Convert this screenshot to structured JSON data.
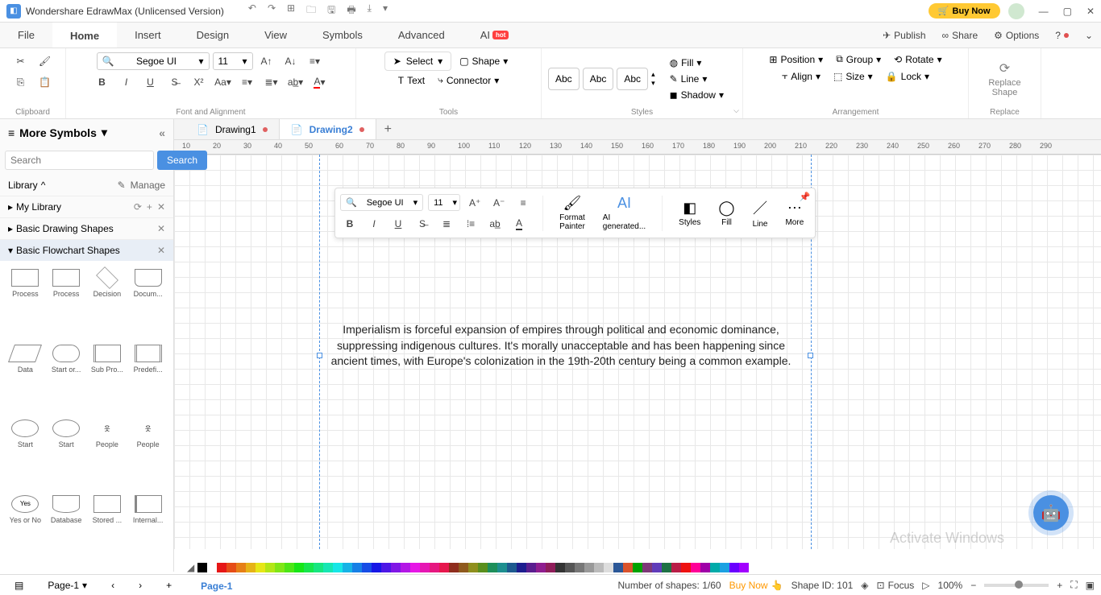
{
  "titlebar": {
    "app_title": "Wondershare EdrawMax (Unlicensed Version)",
    "buynow": "Buy Now"
  },
  "menubar": {
    "file": "File",
    "home": "Home",
    "insert": "Insert",
    "design": "Design",
    "view": "View",
    "symbols": "Symbols",
    "advanced": "Advanced",
    "ai": "AI",
    "hot": "hot",
    "publish": "Publish",
    "share": "Share",
    "options": "Options"
  },
  "ribbon": {
    "clipboard_label": "Clipboard",
    "font_name": "Segoe UI",
    "font_size": "11",
    "font_group_label": "Font and Alignment",
    "select": "Select",
    "shape": "Shape",
    "text": "Text",
    "connector": "Connector",
    "tools_label": "Tools",
    "abc": "Abc",
    "styles_label": "Styles",
    "fill": "Fill",
    "line": "Line",
    "shadow": "Shadow",
    "position": "Position",
    "group": "Group",
    "rotate": "Rotate",
    "align": "Align",
    "size": "Size",
    "lock": "Lock",
    "arrangement_label": "Arrangement",
    "replace_shape": "Replace\nShape",
    "replace_label": "Replace"
  },
  "doc_tabs": {
    "tab1": "Drawing1",
    "tab2": "Drawing2"
  },
  "sidebar": {
    "more_symbols": "More Symbols",
    "search_placeholder": "Search",
    "search_btn": "Search",
    "library": "Library",
    "manage": "Manage",
    "my_library": "My Library",
    "basic_drawing": "Basic Drawing Shapes",
    "basic_flowchart": "Basic Flowchart Shapes",
    "shapes": [
      "Process",
      "Process",
      "Decision",
      "Docum...",
      "Data",
      "Start or...",
      "Sub Pro...",
      "Predefi...",
      "Start",
      "Start",
      "People",
      "People",
      "Yes or No",
      "Database",
      "Stored ...",
      "Internal..."
    ]
  },
  "float_toolbar": {
    "font": "Segoe UI",
    "size": "11",
    "format_painter": "Format\nPainter",
    "ai_generated": "AI\ngenerated...",
    "styles": "Styles",
    "fill": "Fill",
    "line": "Line",
    "more": "More"
  },
  "canvas": {
    "text": "Imperialism is forceful expansion of empires through political and economic dominance, suppressing indigenous cultures. It's morally unacceptable and has been happening since ancient times, with Europe's colonization in the 19th-20th century being a common example."
  },
  "ruler": [
    "10",
    "20",
    "30",
    "40",
    "50",
    "60",
    "70",
    "80",
    "90",
    "100",
    "110",
    "120",
    "130",
    "140",
    "150",
    "160",
    "170",
    "180",
    "190",
    "200",
    "210",
    "220",
    "230",
    "240",
    "250",
    "260",
    "270",
    "280",
    "290"
  ],
  "colorbar": [
    "#000",
    "#fff",
    "#e61717",
    "#e64d17",
    "#e68017",
    "#e6b317",
    "#e6e617",
    "#b3e617",
    "#80e617",
    "#4de617",
    "#17e617",
    "#17e64d",
    "#17e680",
    "#17e6b3",
    "#17e6e6",
    "#17b3e6",
    "#1780e6",
    "#174de6",
    "#1717e6",
    "#4d17e6",
    "#8017e6",
    "#b317e6",
    "#e617e6",
    "#e617b3",
    "#e61780",
    "#e6174d",
    "#8f2d1d",
    "#8f5a1d",
    "#8f8f1d",
    "#5a8f1d",
    "#1d8f5a",
    "#1d8f8f",
    "#1d5a8f",
    "#1d1d8f",
    "#5a1d8f",
    "#8f1d8f",
    "#8f1d5a",
    "#333",
    "#555",
    "#777",
    "#999",
    "#bbb",
    "#ddd",
    "#2b5797",
    "#da532c",
    "#00a300",
    "#7e3878",
    "#603cba",
    "#1e7145",
    "#b91d47",
    "#ee1111",
    "#ff0097",
    "#9f00a7",
    "#00aba9",
    "#1ba1e2",
    "#6a00ff",
    "#a200ff"
  ],
  "statusbar": {
    "page": "Page-1",
    "page_tab": "Page-1",
    "shapes_count": "Number of shapes: 1/60",
    "buynow": "Buy Now",
    "shape_id": "Shape ID: 101",
    "focus": "Focus",
    "zoom": "100%"
  },
  "watermark": "Activate Windows"
}
